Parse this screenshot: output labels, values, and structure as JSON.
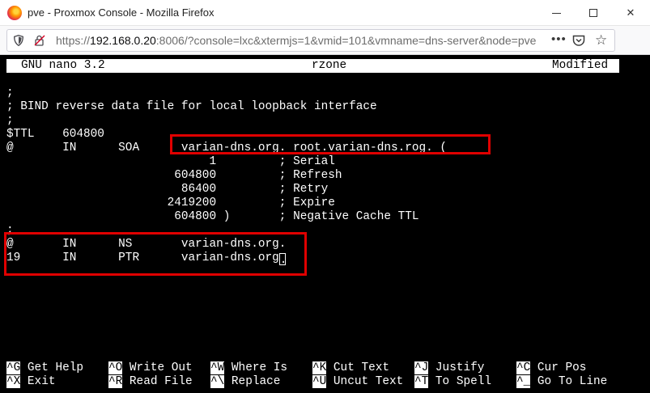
{
  "window": {
    "title": "pve - Proxmox Console - Mozilla Firefox",
    "minimize_glyph": "—",
    "close_glyph": "✕"
  },
  "urlbar": {
    "url_prefix": "https://",
    "url_host": "192.168.0.20",
    "url_rest": ":8006/?console=lxc&xtermjs=1&vmid=101&vmname=dns-server&node=pve",
    "page_actions": "•••",
    "bookmark_glyph": "☆"
  },
  "nano": {
    "app": "GNU nano 3.2",
    "filename": "rzone",
    "status": "Modified",
    "lines": [
      ";",
      "; BIND reverse data file for local loopback interface",
      ";",
      "$TTL    604800",
      "@       IN      SOA      varian-dns.org. root.varian-dns.rog. (",
      "                             1         ; Serial",
      "                        604800         ; Refresh",
      "                         86400         ; Retry",
      "                       2419200         ; Expire",
      "                        604800 )       ; Negative Cache TTL",
      ";",
      "@       IN      NS       varian-dns.org.",
      "19      IN      PTR      varian-dns.org"
    ],
    "cursor_char": ".",
    "shortcuts": [
      [
        {
          "key": "^G",
          "label": "Get Help"
        },
        {
          "key": "^X",
          "label": "Exit"
        }
      ],
      [
        {
          "key": "^O",
          "label": "Write Out"
        },
        {
          "key": "^R",
          "label": "Read File"
        }
      ],
      [
        {
          "key": "^W",
          "label": "Where Is"
        },
        {
          "key": "^\\",
          "label": "Replace"
        }
      ],
      [
        {
          "key": "^K",
          "label": "Cut Text"
        },
        {
          "key": "^U",
          "label": "Uncut Text"
        }
      ],
      [
        {
          "key": "^J",
          "label": "Justify"
        },
        {
          "key": "^T",
          "label": "To Spell"
        }
      ],
      [
        {
          "key": "^C",
          "label": "Cur Pos"
        },
        {
          "key": "^_",
          "label": "Go To Line"
        }
      ]
    ]
  },
  "colors": {
    "highlight_box": "#e00000",
    "terminal_bg": "#000000",
    "terminal_fg": "#ffffff"
  }
}
